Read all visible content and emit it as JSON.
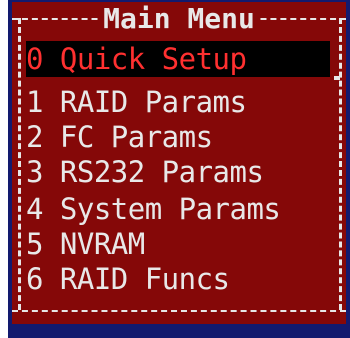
{
  "menu": {
    "title": "Main Menu",
    "items": [
      {
        "key": "0",
        "label": "0 Quick Setup",
        "selected": true
      },
      {
        "key": "1",
        "label": "1 RAID Params",
        "selected": false
      },
      {
        "key": "2",
        "label": "2 FC Params",
        "selected": false
      },
      {
        "key": "3",
        "label": "3 RS232 Params",
        "selected": false
      },
      {
        "key": "4",
        "label": "4 System Params",
        "selected": false
      },
      {
        "key": "5",
        "label": "5 NVRAM",
        "selected": false
      },
      {
        "key": "6",
        "label": "6 RAID Funcs",
        "selected": false
      }
    ]
  },
  "colors": {
    "menu_background": "#850808",
    "outer_frame": "#121a6e",
    "text": "#e8e8e8",
    "selected_text": "#ff3030",
    "selected_background": "#000000"
  }
}
